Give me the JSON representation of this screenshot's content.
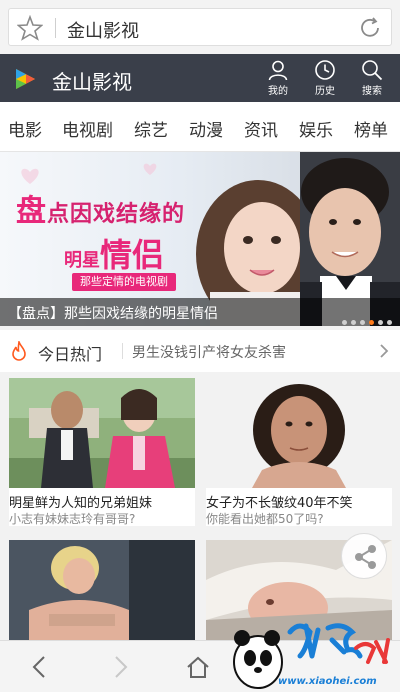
{
  "browser": {
    "title": "金山影视"
  },
  "header": {
    "app_title": "金山影视",
    "buttons": [
      {
        "label": "我的",
        "icon": "person-icon"
      },
      {
        "label": "历史",
        "icon": "clock-icon"
      },
      {
        "label": "搜索",
        "icon": "search-icon"
      }
    ]
  },
  "categories": [
    "电影",
    "电视剧",
    "综艺",
    "动漫",
    "资讯",
    "娱乐",
    "榜单"
  ],
  "banner": {
    "head_line1_a": "盘",
    "head_line1_b": "点因戏结缘的",
    "head_line2_a": "明星",
    "head_line2_b": "情侣",
    "tag": "那些定情的电视剧",
    "caption": "【盘点】那些因戏结缘的明星情侣",
    "slide_count": 6,
    "active_slide": 4
  },
  "hot": {
    "title": "今日热门",
    "headline": "男生没钱引产将女友杀害"
  },
  "cards": [
    {
      "title": "明星鲜为人知的兄弟姐妹",
      "subtitle": "小志有妹妹志玲有哥哥?"
    },
    {
      "title": "女子为不长皱纹40年不笑",
      "subtitle": "你能看出她都50了吗?"
    },
    {
      "title": "",
      "subtitle": ""
    },
    {
      "title": "",
      "subtitle": ""
    }
  ],
  "watermark": {
    "text": "www.xiaohei.com"
  },
  "colors": {
    "header_bg": "#3a3f4a",
    "accent_pink": "#e8287a",
    "hot_orange": "#ff5a1f",
    "subtitle_gray": "#888888"
  }
}
